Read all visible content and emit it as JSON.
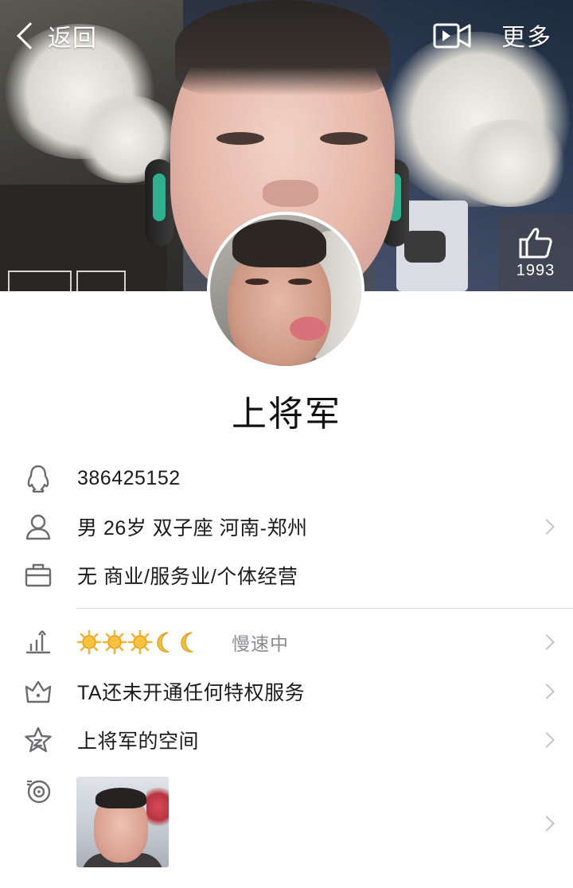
{
  "topbar": {
    "back_label": "返回",
    "more_label": "更多"
  },
  "cover": {
    "like_count": "1993"
  },
  "profile": {
    "name": "上将军"
  },
  "info": {
    "qq_number": "386425152",
    "basic": "男 26岁 双子座 河南-郑州",
    "job": "无 商业/服务业/个体经营"
  },
  "rows": {
    "level_icons": [
      "sun-icon",
      "sun-icon",
      "sun-icon",
      "moon-icon",
      "moon-icon"
    ],
    "level_status": "慢速中",
    "privilege": "TA还未开通任何特权服务",
    "qzone": "上将军的空间"
  },
  "colors": {
    "text_primary": "#1b1b1b",
    "text_secondary": "#8b8b90",
    "divider": "#dcdcdf",
    "arrow": "#c4c4c8",
    "icon_stroke": "#6b6b70",
    "level_sun": "#f5b325",
    "level_moon": "#f2c23a"
  }
}
